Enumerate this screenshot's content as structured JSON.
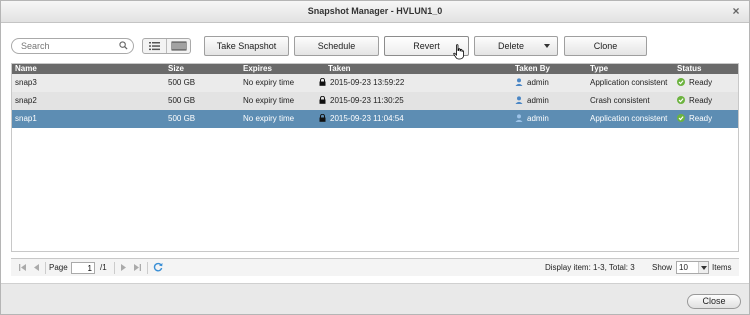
{
  "window": {
    "title": "Snapshot Manager - HVLUN1_0",
    "close_glyph": "×"
  },
  "search": {
    "placeholder": "Search"
  },
  "toolbar": {
    "take_snapshot": "Take Snapshot",
    "schedule": "Schedule",
    "revert": "Revert",
    "delete": "Delete",
    "clone": "Clone"
  },
  "table": {
    "headers": {
      "name": "Name",
      "size": "Size",
      "expires": "Expires",
      "taken": "Taken",
      "taken_by": "Taken By",
      "type": "Type",
      "status": "Status"
    },
    "rows": [
      {
        "name": "snap3",
        "size": "500 GB",
        "expires": "No expiry time",
        "taken": "2015-09-23 13:59:22",
        "taken_by": "admin",
        "type": "Application consistent",
        "status": "Ready"
      },
      {
        "name": "snap2",
        "size": "500 GB",
        "expires": "No expiry time",
        "taken": "2015-09-23 11:30:25",
        "taken_by": "admin",
        "type": "Crash consistent",
        "status": "Ready"
      },
      {
        "name": "snap1",
        "size": "500 GB",
        "expires": "No expiry time",
        "taken": "2015-09-23 11:04:54",
        "taken_by": "admin",
        "type": "Application consistent",
        "status": "Ready"
      }
    ],
    "selected_row": "snap1"
  },
  "pagination": {
    "page_label": "Page",
    "current_page": "1",
    "total_pages": "/1",
    "display_info": "Display item: 1-3, Total: 3",
    "show_label": "Show",
    "page_size": "10",
    "items_label": "Items"
  },
  "footer": {
    "close": "Close"
  },
  "colors": {
    "header_bg": "#6a6a6a",
    "selected_row": "#5d8db3",
    "alt_row": "#ebebeb",
    "status_ok": "#6cb33f",
    "user_icon": "#4a86c5"
  },
  "icons": [
    "search-icon",
    "list-view-icon",
    "detail-view-icon",
    "lock-icon",
    "user-icon",
    "ready-check-icon",
    "first-page-icon",
    "prev-page-icon",
    "next-page-icon",
    "last-page-icon",
    "refresh-icon",
    "hand-cursor-icon"
  ]
}
